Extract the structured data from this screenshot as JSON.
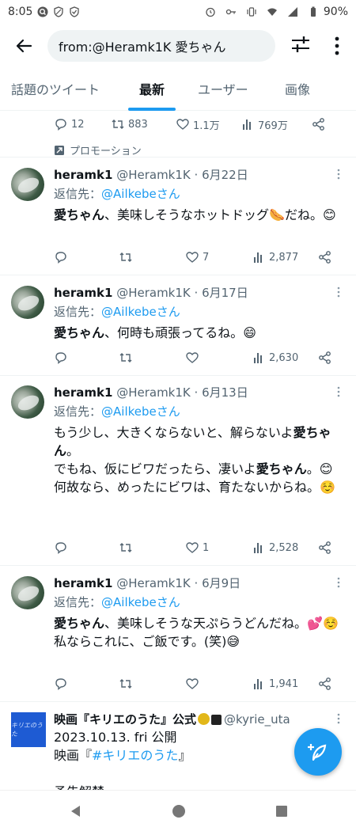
{
  "statusbar": {
    "time": "8:05",
    "battery": "90%"
  },
  "search": {
    "query": "from:@Heramk1K 愛ちゃん"
  },
  "tabs": [
    {
      "label": "話題のツイート"
    },
    {
      "label": "最新"
    },
    {
      "label": "ユーザー"
    },
    {
      "label": "画像"
    }
  ],
  "promo_tweet": {
    "replies": "12",
    "retweets": "883",
    "likes": "1.1万",
    "views": "769万",
    "promo_label": "プロモーション"
  },
  "tweets": [
    {
      "name": "heramk1",
      "handle": "@Heramk1K",
      "date": "· 6月22日",
      "reply_prefix": "返信先：",
      "reply_to": "@Ailkebeさん",
      "bold": "愛ちゃん",
      "text_after": "、美味しそうなホットドッグ🌭だね。😊",
      "likes": "7",
      "views": "2,877"
    },
    {
      "name": "heramk1",
      "handle": "@Heramk1K",
      "date": "· 6月17日",
      "reply_prefix": "返信先：",
      "reply_to": "@Ailkebeさん",
      "bold": "愛ちゃん",
      "text_after": "、何時も頑張ってるね。😄",
      "views": "2,630"
    },
    {
      "name": "heramk1",
      "handle": "@Heramk1K",
      "date": "· 6月13日",
      "reply_prefix": "返信先：",
      "reply_to": "@Ailkebeさん",
      "line1a": "もう少し、大きくならないと、解らないよ",
      "line1b": "愛ちゃん",
      "line1c": "。",
      "line2a": "でもね、仮にビワだったら、凄いよ",
      "line2b": "愛ちゃん",
      "line2c": "。😊",
      "line3": "何故なら、めったにビワは、育たないからね。☺️",
      "likes": "1",
      "views": "2,528"
    },
    {
      "name": "heramk1",
      "handle": "@Heramk1K",
      "date": "· 6月9日",
      "reply_prefix": "返信先：",
      "reply_to": "@Ailkebeさん",
      "bold": "愛ちゃん",
      "text_after": "、美味しそうな天ぷらうどんだね。💕☺️",
      "line2": "私ならこれに、ご飯です。(笑)😅",
      "views": "1,941"
    }
  ],
  "film": {
    "name": "映画『キリエのうた』公式",
    "handle": "@kyrie_uta",
    "line1": "2023.10.13. fri 公開",
    "line2_prefix": "映画『",
    "line2_link": "#キリエのうた",
    "line2_suffix": "』",
    "line3": "予告解禁",
    "logo_text": "キリエのうた"
  }
}
